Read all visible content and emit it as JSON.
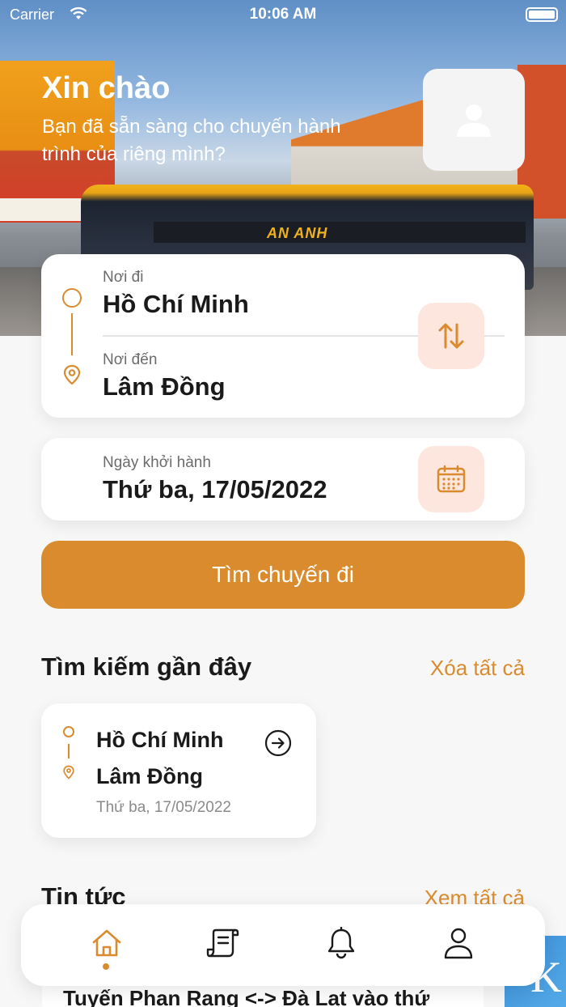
{
  "status_bar": {
    "carrier": "Carrier",
    "time": "10:06 AM"
  },
  "header": {
    "greeting": "Xin chào",
    "subtitle": "Bạn đã sẵn sàng cho chuyến hành trình của riêng mình?",
    "bus_brand": "AN ANH"
  },
  "route": {
    "from_label": "Nơi đi",
    "from_value": "Hồ Chí Minh",
    "to_label": "Nơi đến",
    "to_value": "Lâm Đồng"
  },
  "date": {
    "label": "Ngày khởi hành",
    "value": "Thứ ba, 17/05/2022"
  },
  "search_button": "Tìm chuyến đi",
  "recent": {
    "title": "Tìm kiếm gần đây",
    "clear_all": "Xóa tất cả",
    "items": [
      {
        "from": "Hồ Chí Minh",
        "to": "Lâm Đồng",
        "date": "Thứ ba, 17/05/2022"
      }
    ]
  },
  "news": {
    "title": "Tin tức",
    "see_all": "Xem tất cả",
    "items": [
      {
        "title": "Tuyến Phan Rang <-> Đà Lạt vào thứ"
      },
      {
        "title": "K"
      }
    ]
  },
  "tabbar": {
    "active": "home",
    "tabs": [
      "home-icon",
      "tickets-icon",
      "bell-icon",
      "profile-icon"
    ]
  },
  "colors": {
    "accent": "#d98b2e",
    "accent_soft": "#fde6de"
  }
}
